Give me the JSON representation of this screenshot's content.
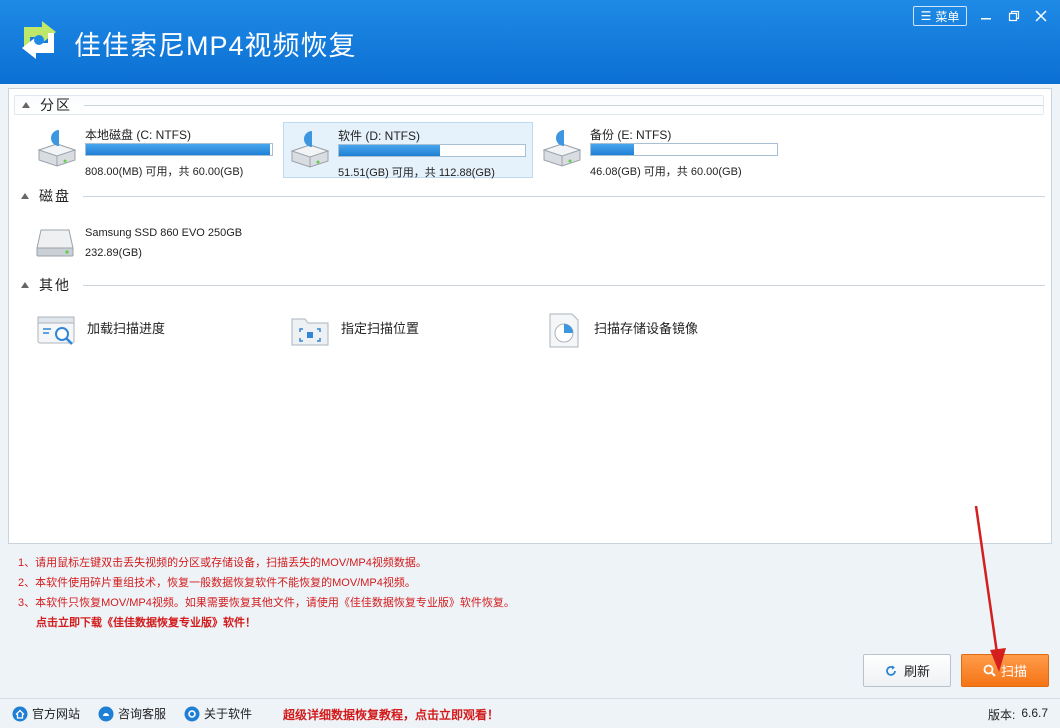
{
  "app": {
    "title": "佳佳索尼MP4视频恢复",
    "menu_label": "菜单"
  },
  "colors": {
    "titlebar": "#0b6fd2",
    "accent_orange": "#f57416",
    "note_red": "#d21c1c",
    "selection": "#e5f1fb"
  },
  "sections": {
    "partition": "分区",
    "disk": "磁盘",
    "other": "其他"
  },
  "partitions": [
    {
      "name": "本地磁盘 (C: NTFS)",
      "info": "808.00(MB) 可用，共 60.00(GB)",
      "used_percent": 98.7,
      "selected": false
    },
    {
      "name": "软件 (D: NTFS)",
      "info": "51.51(GB) 可用，共 112.88(GB)",
      "used_percent": 54.4,
      "selected": true
    },
    {
      "name": "备份 (E: NTFS)",
      "info": "46.08(GB) 可用，共 60.00(GB)",
      "used_percent": 23.2,
      "selected": false
    }
  ],
  "disk": {
    "name": "Samsung SSD 860 EVO 250GB",
    "size": "232.89(GB)"
  },
  "others": [
    {
      "label": "加载扫描进度",
      "icon": "load-progress-icon"
    },
    {
      "label": "指定扫描位置",
      "icon": "folder-target-icon"
    },
    {
      "label": "扫描存储设备镜像",
      "icon": "disk-image-icon"
    }
  ],
  "notes": [
    "1、请用鼠标左键双击丢失视频的分区或存储设备，扫描丢失的MOV/MP4视频数据。",
    "2、本软件使用碎片重组技术，恢复一般数据恢复软件不能恢复的MOV/MP4视频。",
    "3、本软件只恢复MOV/MP4视频。如果需要恢复其他文件，请使用《佳佳数据恢复专业版》软件恢复。",
    "点击立即下载《佳佳数据恢复专业版》软件！"
  ],
  "buttons": {
    "refresh": "刷新",
    "scan": "扫描"
  },
  "footer": {
    "website": "官方网站",
    "support": "咨询客服",
    "about": "关于软件",
    "promo": "超级详细数据恢复教程，点击立即观看！",
    "version_label": "版本:",
    "version": "6.6.7"
  }
}
